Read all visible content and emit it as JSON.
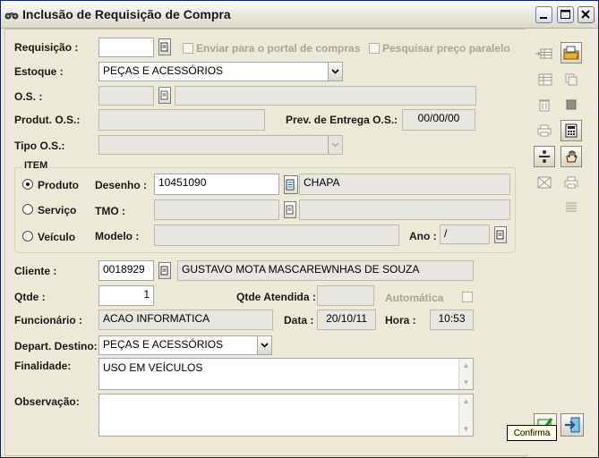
{
  "window": {
    "title": "Inclusão de Requisição de Compra",
    "app_icon": "binoculars-icon",
    "controls": [
      "minimize-icon",
      "maximize-icon",
      "close-icon"
    ]
  },
  "form": {
    "requisicao": {
      "label": "Requisição :",
      "value": ""
    },
    "enviar_portal": {
      "label": "Enviar para o portal de compras",
      "checked": false,
      "enabled": false
    },
    "pesquisar_preco": {
      "label": "Pesquisar preço paralelo",
      "checked": false,
      "enabled": false
    },
    "estoque": {
      "label": "Estoque :",
      "value": "PEÇAS E ACESSÓRIOS"
    },
    "os": {
      "label": "O.S. :",
      "code": "",
      "description": ""
    },
    "produt_os": {
      "label": "Produt. O.S.:",
      "value": ""
    },
    "prev_entrega": {
      "label": "Prev. de Entrega O.S.:",
      "value": "00/00/00"
    },
    "tipo_os": {
      "label": "Tipo O.S.:",
      "value": ""
    },
    "item": {
      "group_label": "ITEM",
      "selected": "produto",
      "produto": {
        "radio_label": "Produto",
        "field_label": "Desenho :",
        "code": "10451090",
        "description": "CHAPA"
      },
      "servico": {
        "radio_label": "Serviço",
        "field_label": "TMO :",
        "code": "",
        "description": ""
      },
      "veiculo": {
        "radio_label": "Veículo",
        "field_label": "Modelo :",
        "value": "",
        "ano_label": "Ano :",
        "ano_value": "/"
      }
    },
    "cliente": {
      "label": "Cliente :",
      "code": "0018929",
      "name": "GUSTAVO MOTA MASCAREWNHAS DE SOUZA"
    },
    "qtde": {
      "label": "Qtde :",
      "value": "1"
    },
    "qtde_atendida": {
      "label": "Qtde Atendida :",
      "value": ""
    },
    "automatica": {
      "label": "Automática",
      "checked": false,
      "enabled": false
    },
    "funcionario": {
      "label": "Funcionário :",
      "value": "ACAO INFORMATICA"
    },
    "data": {
      "label": "Data :",
      "value": "20/10/11"
    },
    "hora": {
      "label": "Hora :",
      "value": "10:53"
    },
    "depart_destino": {
      "label": "Depart. Destino:",
      "value": "PEÇAS E ACESSÓRIOS"
    },
    "finalidade": {
      "label": "Finalidade:",
      "value": "USO EM VEÍCULOS"
    },
    "observacao": {
      "label": "Observação:",
      "value": ""
    }
  },
  "toolbar": {
    "tooltip": "Confirma",
    "buttons": [
      "add-row-icon",
      "folder-icon",
      "list-add-icon",
      "copy-icon",
      "trash-icon",
      "stop-icon",
      "printer-icon",
      "calculator-icon",
      "divide-icon",
      "hand-icon",
      "grid-cancel-icon",
      "printer-alt-icon",
      "lines-icon",
      "confirm-icon",
      "exit-icon"
    ]
  },
  "colors": {
    "title_text": "#1a1a1a",
    "disabled_text": "#a9a698",
    "window_bg": "#ece9d8",
    "readonly_field": "#e7e6e0",
    "tooltip_bg": "#ffffe1"
  }
}
